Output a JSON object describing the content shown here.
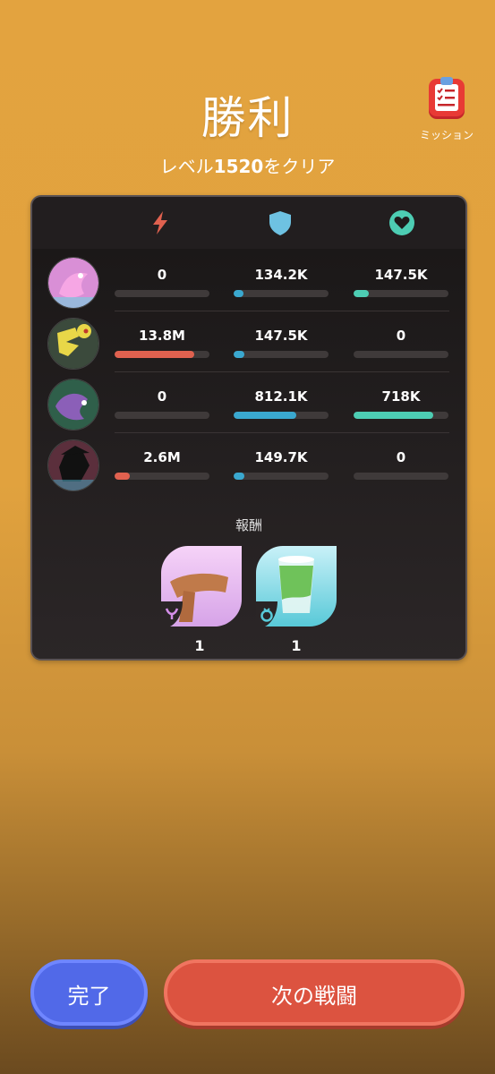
{
  "header": {
    "title": "勝利",
    "subtitle_prefix": "レベル",
    "subtitle_level": "1520",
    "subtitle_suffix": "をクリア",
    "mission_label": "ミッション"
  },
  "stats_header": {
    "icons": [
      "lightning-icon",
      "shield-icon",
      "heart-icon"
    ],
    "colors": {
      "damage": "#e0614f",
      "shield": "#3aa8cf",
      "heal": "#4dcdb3"
    }
  },
  "heroes": [
    {
      "avatar": "pink-dragon-avatar",
      "damage": "0",
      "shield": "134.2K",
      "heal": "147.5K",
      "damage_ratio": 0.0,
      "shield_ratio": 0.1,
      "heal_ratio": 0.16
    },
    {
      "avatar": "yellow-hydra-avatar",
      "damage": "13.8M",
      "shield": "147.5K",
      "heal": "0",
      "damage_ratio": 0.84,
      "shield_ratio": 0.11,
      "heal_ratio": 0.0
    },
    {
      "avatar": "purple-dragon-avatar",
      "damage": "0",
      "shield": "812.1K",
      "heal": "718K",
      "damage_ratio": 0.0,
      "shield_ratio": 0.66,
      "heal_ratio": 0.84
    },
    {
      "avatar": "shadow-mage-avatar",
      "damage": "2.6M",
      "shield": "149.7K",
      "heal": "0",
      "damage_ratio": 0.16,
      "shield_ratio": 0.11,
      "heal_ratio": 0.0
    }
  ],
  "rewards": {
    "label": "報酬",
    "items": [
      {
        "name": "scarf-reward",
        "count": "1",
        "slot_icon": "necklace-icon"
      },
      {
        "name": "green-cup-reward",
        "count": "1",
        "slot_icon": "ring-icon"
      }
    ]
  },
  "buttons": {
    "done": "完了",
    "next": "次の戦闘"
  }
}
